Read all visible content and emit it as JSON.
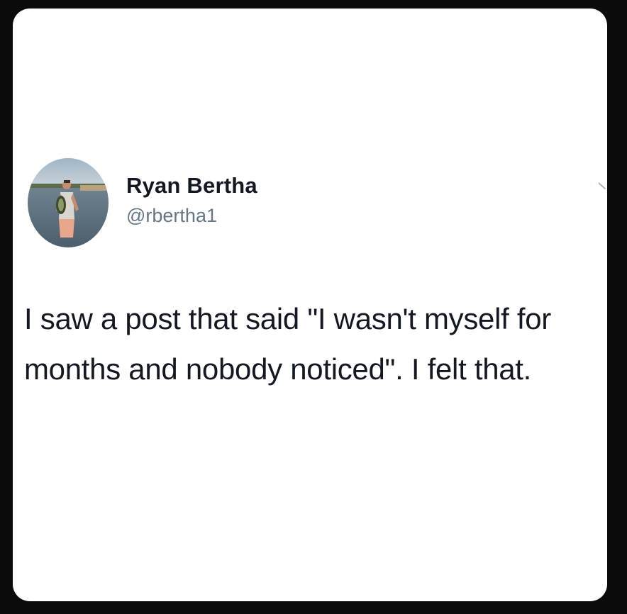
{
  "tweet": {
    "author": {
      "display_name": "Ryan Bertha",
      "handle": "@rbertha1",
      "avatar_icon": "profile-photo-fisherman"
    },
    "text": "I saw a post that said \"I wasn't myself for months and nobody noticed\". I felt that.",
    "menu_icon": "chevron-down-icon"
  },
  "colors": {
    "page_background": "#0b0b0b",
    "card_background": "#ffffff",
    "text_primary": "#141823",
    "text_secondary": "#657786"
  }
}
